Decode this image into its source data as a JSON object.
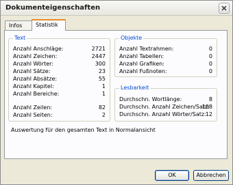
{
  "window": {
    "title": "Dokumenteigenschaften"
  },
  "tabs": [
    {
      "label": "Infos",
      "active": false
    },
    {
      "label": "Statistik",
      "active": true
    }
  ],
  "text_group": {
    "title": "Text",
    "rows": [
      {
        "label": "Anzahl Anschläge:",
        "value": "2721"
      },
      {
        "label": "Anzahl Zeichen:",
        "value": "2447"
      },
      {
        "label": "Anzahl Wörter:",
        "value": "300"
      },
      {
        "label": "Anzahl Sätze:",
        "value": "23"
      },
      {
        "label": "Anzahl Absätze:",
        "value": "55"
      },
      {
        "label": "Anzahl Kapitel:",
        "value": "1"
      },
      {
        "label": "Anzahl Bereiche:",
        "value": "1"
      },
      {
        "label": "Anzahl Zeilen:",
        "value": "82"
      },
      {
        "label": "Anzahl Seiten:",
        "value": "2"
      }
    ]
  },
  "objects_group": {
    "title": "Objekte",
    "rows": [
      {
        "label": "Anzahl Textrahmen:",
        "value": "0"
      },
      {
        "label": "Anzahl Tabellen:",
        "value": "0"
      },
      {
        "label": "Anzahl Grafiken:",
        "value": "0"
      },
      {
        "label": "Anzahl Fußnoten:",
        "value": "0"
      }
    ]
  },
  "readability_group": {
    "title": "Lesbarkeit",
    "rows": [
      {
        "label": "Durchschn. Wortlänge:",
        "value": "8"
      },
      {
        "label": "Durchschn. Anzahl Zeichen/Satz:",
        "value": "108"
      },
      {
        "label": "Durchschn. Anzahl Wörter/Satz:",
        "value": "12"
      }
    ]
  },
  "footnote": "Auswertung für den gesamten Text in Normalansicht",
  "buttons": {
    "ok": "OK",
    "cancel": "Abbrechen"
  },
  "colors": {
    "group_title": "#0046d5",
    "active_tab_accent": "#e68b2c",
    "dialog_bg": "#ece9d8"
  },
  "icons": {
    "close": "close-icon"
  }
}
